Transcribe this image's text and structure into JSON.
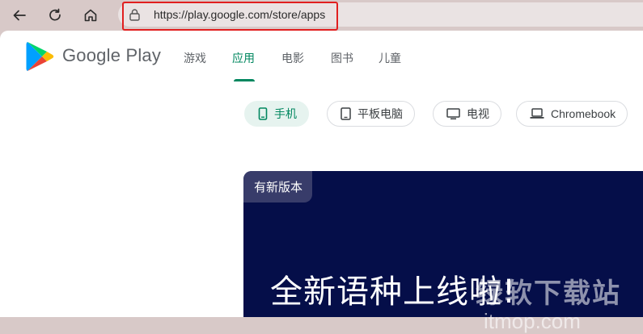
{
  "browser": {
    "url": "https://play.google.com/store/apps"
  },
  "header": {
    "brand": "Google Play",
    "nav": [
      {
        "label": "游戏",
        "active": false
      },
      {
        "label": "应用",
        "active": true
      },
      {
        "label": "电影",
        "active": false
      },
      {
        "label": "图书",
        "active": false
      },
      {
        "label": "儿童",
        "active": false
      }
    ]
  },
  "device_filters": [
    {
      "label": "手机",
      "icon": "phone-icon",
      "selected": true
    },
    {
      "label": "平板电脑",
      "icon": "tablet-icon",
      "selected": false
    },
    {
      "label": "电视",
      "icon": "tv-icon",
      "selected": false
    },
    {
      "label": "Chromebook",
      "icon": "laptop-icon",
      "selected": false
    }
  ],
  "banner": {
    "badge": "有新版本",
    "headline": "全新语种上线啦!"
  },
  "watermark": {
    "text_cn": "绿软下载站",
    "text_en": "itmop.com"
  },
  "colors": {
    "accent": "#01875f",
    "banner_bg": "#050e49",
    "highlight": "#e11f1f",
    "browser_chrome": "#d8c9c8"
  }
}
